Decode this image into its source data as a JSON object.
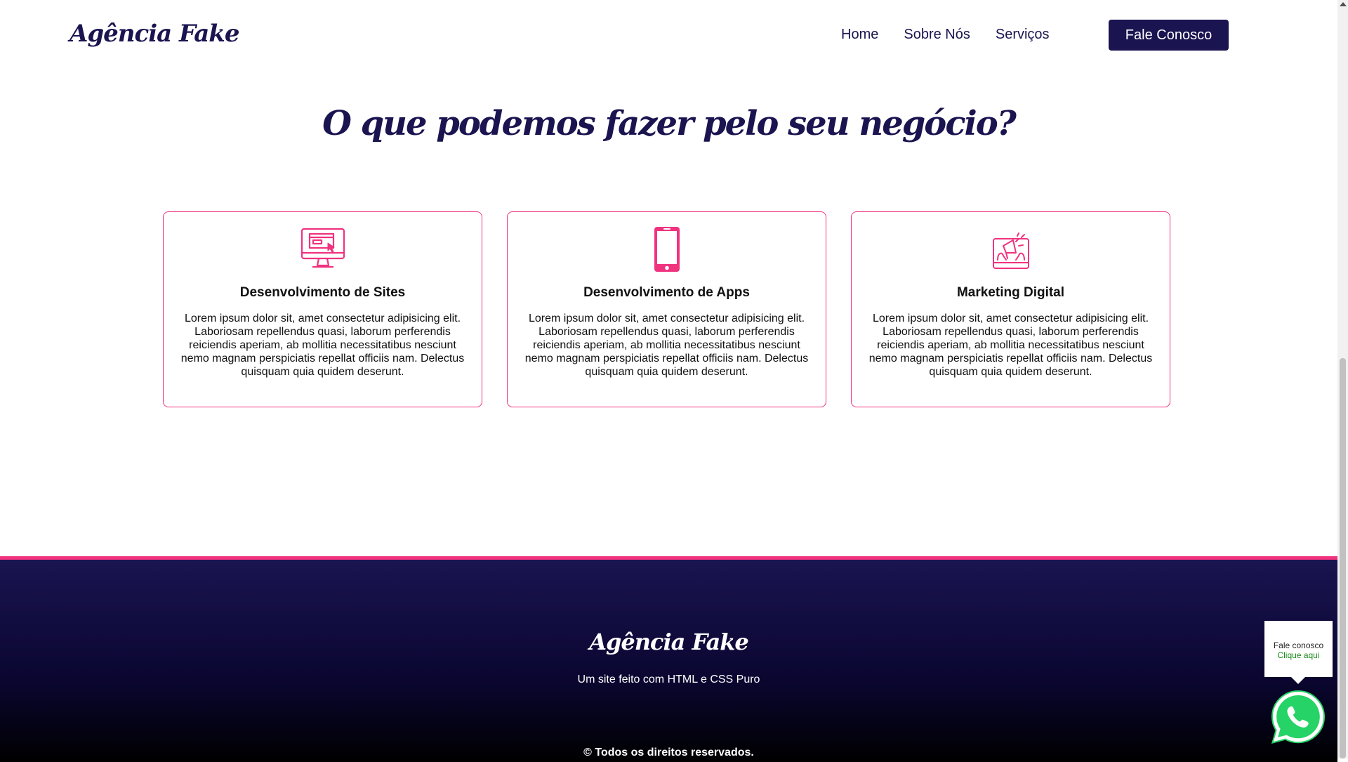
{
  "nav": {
    "logo": "Agência Fake",
    "links": [
      "Home",
      "Sobre Nós",
      "Serviços"
    ],
    "cta": "Fale Conosco"
  },
  "services": {
    "title": "O que podemos fazer pelo seu negócio?",
    "cards": [
      {
        "icon": "monitor-icon",
        "title": "Desenvolvimento de Sites",
        "text": "Lorem ipsum dolor sit, amet consectetur adipisicing elit. Laboriosam repellendus quasi, laborum perferendis reiciendis aperiam, ab mollitia necessitatibus nesciunt nemo magnam perspiciatis repellat officiis nam. Delectus quisquam quia quidem deserunt."
      },
      {
        "icon": "smartphone-icon",
        "title": "Desenvolvimento de Apps",
        "text": "Lorem ipsum dolor sit, amet consectetur adipisicing elit. Laboriosam repellendus quasi, laborum perferendis reiciendis aperiam, ab mollitia necessitatibus nesciunt nemo magnam perspiciatis repellat officiis nam. Delectus quisquam quia quidem deserunt."
      },
      {
        "icon": "megaphone-icon",
        "title": "Marketing Digital",
        "text": "Lorem ipsum dolor sit, amet consectetur adipisicing elit. Laboriosam repellendus quasi, laborum perferendis reiciendis aperiam, ab mollitia necessitatibus nesciunt nemo magnam perspiciatis repellat officiis nam. Delectus quisquam quia quidem deserunt."
      }
    ]
  },
  "footer": {
    "logo": "Agência Fake",
    "subtitle": "Um site feito com HTML e CSS Puro",
    "copyright": "© Todos os direitos reservados."
  },
  "whatsapp": {
    "title": "Fale conosco",
    "link": "Clique aqui",
    "icon": "whatsapp-icon"
  },
  "colors": {
    "primary": "#1a1450",
    "accent": "#f0337f",
    "whatsapp": "#25d366"
  }
}
